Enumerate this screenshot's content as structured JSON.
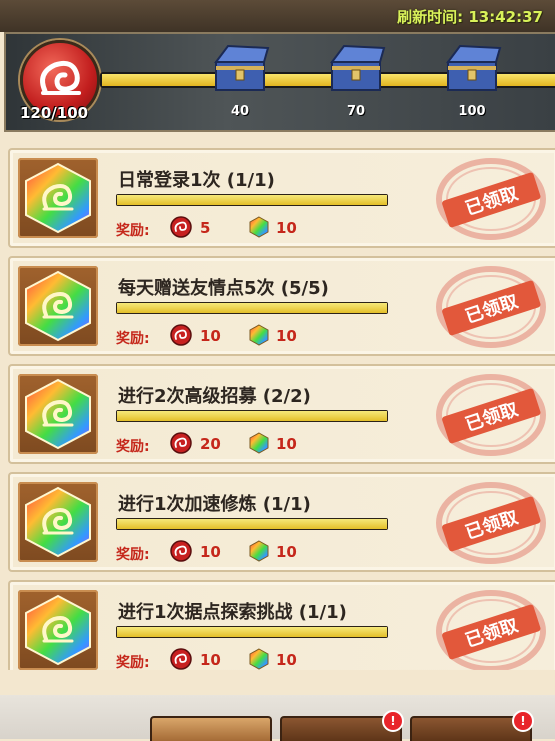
{
  "header": {
    "refresh_label": "刷新时间:",
    "refresh_time": "13:42:37"
  },
  "progress": {
    "current_text": "120/100",
    "fill_fraction": 1.0,
    "chests": [
      {
        "label": "40"
      },
      {
        "label": "70"
      },
      {
        "label": "100"
      }
    ]
  },
  "tasks": [
    {
      "title": "日常登录1次 (1/1)",
      "progress_fraction": 1.0,
      "reward_label": "奖励:",
      "reward1": "5",
      "reward2": "10",
      "status": "已领取"
    },
    {
      "title": "每天赠送友情点5次 (5/5)",
      "progress_fraction": 1.0,
      "reward_label": "奖励:",
      "reward1": "10",
      "reward2": "10",
      "status": "已领取"
    },
    {
      "title": "进行2次高级招募 (2/2)",
      "progress_fraction": 1.0,
      "reward_label": "奖励:",
      "reward1": "20",
      "reward2": "10",
      "status": "已领取"
    },
    {
      "title": "进行1次加速修炼 (1/1)",
      "progress_fraction": 1.0,
      "reward_label": "奖励:",
      "reward1": "10",
      "reward2": "10",
      "status": "已领取"
    },
    {
      "title": "进行1次据点探索挑战 (1/1)",
      "progress_fraction": 1.0,
      "reward_label": "奖励:",
      "reward1": "10",
      "reward2": "10",
      "status": "已领取"
    }
  ],
  "tabs": [
    {
      "badge": "!"
    },
    {
      "badge": "!"
    },
    {
      "badge": "!"
    }
  ],
  "colors": {
    "reward_red": "#c5271b",
    "bar_yellow": "#f1d24a",
    "timer_green": "#d9f25a"
  }
}
